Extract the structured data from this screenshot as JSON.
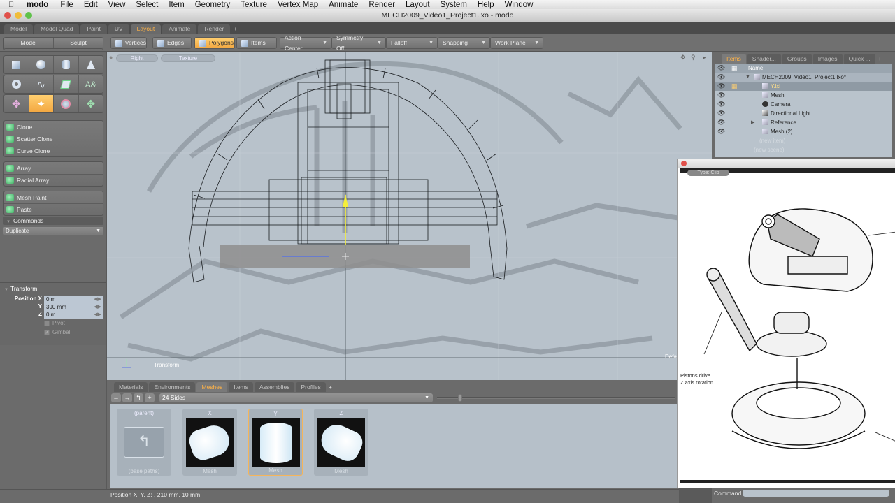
{
  "menubar": {
    "apple": "",
    "app_name": "modo",
    "items": [
      "File",
      "Edit",
      "View",
      "Select",
      "Item",
      "Geometry",
      "Texture",
      "Vertex Map",
      "Animate",
      "Render",
      "Layout",
      "System",
      "Help",
      "Window"
    ]
  },
  "window": {
    "title": "MECH2009_Video1_Project1.lxo - modo",
    "traffic_light_colors": [
      "#e0504a",
      "#f0bd3a",
      "#5fc24a"
    ]
  },
  "layout_tabs": {
    "items": [
      "Model",
      "Model Quad",
      "Paint",
      "UV",
      "Layout",
      "Animate",
      "Render"
    ],
    "active": "Layout",
    "add": "+"
  },
  "toolbar": {
    "selection_modes": [
      "Vertices",
      "Edges",
      "Polygons",
      "Items"
    ],
    "active_mode": "Polygons",
    "dropdowns": [
      "Action Center",
      "Symmetry: Off",
      "Falloff",
      "Snapping",
      "Work Plane"
    ],
    "accent_color": "#f3a740"
  },
  "left_panel": {
    "tabs": [
      "Model",
      "Sculpt"
    ],
    "primitive_icons": [
      "cube-icon",
      "sphere-icon",
      "cylinder-icon",
      "cone-icon"
    ],
    "primitive_icons_row2": [
      "torus-icon",
      "capsule-icon",
      "pen-icon",
      "text-icon"
    ],
    "transform_icons": [
      "move-icon",
      "transform-icon",
      "rotate-icon",
      "scale-icon"
    ],
    "tool_groups": [
      [
        "Clone",
        "Scatter Clone",
        "Curve Clone"
      ],
      [
        "Array",
        "Radial Array"
      ],
      [
        "Mesh Paint",
        "Paste"
      ]
    ],
    "commands_label": "Commands",
    "commands_dropdown": "Duplicate",
    "transform": {
      "title": "Transform",
      "position_x_label": "Position X",
      "y_label": "Y",
      "z_label": "Z",
      "position_x": "0 m",
      "position_y": "390 mm",
      "position_z": "0 m",
      "pivot_label": "Pivot",
      "pivot_checked": false,
      "gimbal_label": "Gimbal",
      "gimbal_checked": true
    }
  },
  "viewport": {
    "view_label": "Right",
    "shading_label": "Texture",
    "tool_label": "Transform",
    "axis_labels": [
      "Y",
      "Z"
    ],
    "corner_hint": "Defa"
  },
  "items_panel": {
    "tabs": [
      "Items",
      "Shader...",
      "Groups",
      "Images",
      "Quick ..."
    ],
    "active_tab": "Items",
    "add": "+",
    "header_name": "Name",
    "rows": [
      {
        "name": "MECH2009_Video1_Project1.lxo*",
        "kind": "scene",
        "expanded": true
      },
      {
        "name": "Y.lxl",
        "kind": "mesh",
        "selected": true
      },
      {
        "name": "Mesh",
        "kind": "mesh"
      },
      {
        "name": "Camera",
        "kind": "camera"
      },
      {
        "name": "Directional Light",
        "kind": "light"
      },
      {
        "name": "Reference",
        "kind": "group",
        "collapsed": true
      },
      {
        "name": "Mesh (2)",
        "kind": "mesh"
      }
    ],
    "new_item": "(new item)",
    "new_scene": "(new scene)"
  },
  "bottom_panel": {
    "tabs": [
      "Materials",
      "Environments",
      "Meshes",
      "Items",
      "Assemblies",
      "Profiles"
    ],
    "active_tab": "Meshes",
    "add": "+",
    "nav_buttons": [
      "back-arrow-icon",
      "forward-arrow-icon",
      "parent-dir-icon",
      "add-icon"
    ],
    "preset_folder": "24 Sides",
    "presets": [
      {
        "caption": "(parent)",
        "footer": "(base paths)",
        "type": "folder"
      },
      {
        "caption": "X",
        "footer": "Mesh",
        "type": "cylinder-x"
      },
      {
        "caption": "Y",
        "footer": "Mesh",
        "type": "cylinder-y",
        "selected": true
      },
      {
        "caption": "Z",
        "footer": "Mesh",
        "type": "cylinder-z"
      }
    ]
  },
  "statusbar": {
    "text": "Position X, Y, Z:   , 210 mm, 10 mm"
  },
  "reference_window": {
    "type_button": "Type: Clip",
    "note_line1": "Pistons drive",
    "note_line2": "Z axis rotation"
  },
  "command_bar": {
    "label": "Command",
    "value": ""
  }
}
